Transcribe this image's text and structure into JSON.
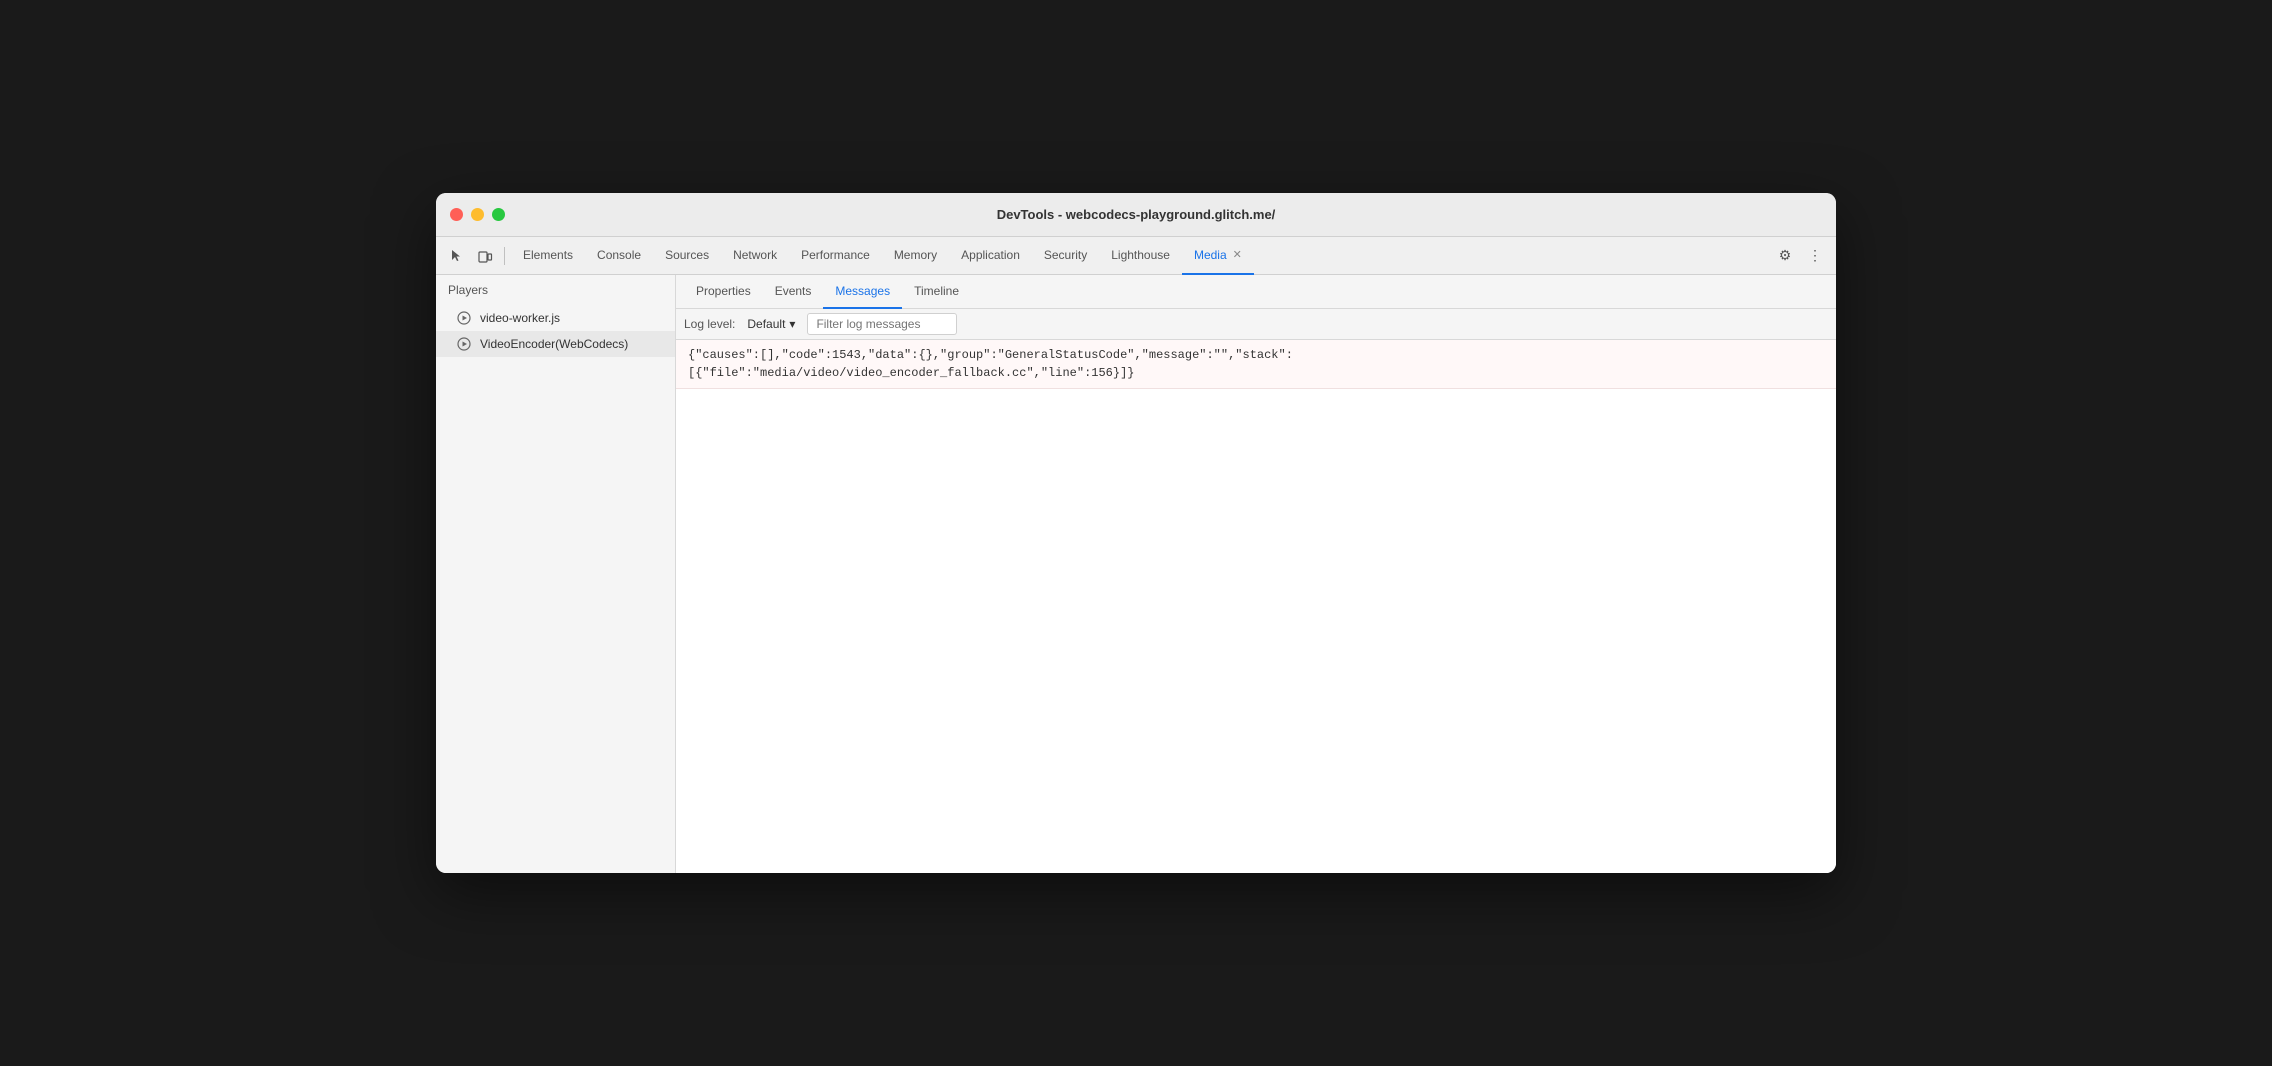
{
  "window": {
    "title": "DevTools - webcodecs-playground.glitch.me/"
  },
  "trafficLights": {
    "red_label": "close",
    "yellow_label": "minimize",
    "green_label": "maximize"
  },
  "toolbar": {
    "inspect_icon": "⬚",
    "device_icon": "▭",
    "tabs": [
      {
        "id": "elements",
        "label": "Elements",
        "active": false
      },
      {
        "id": "console",
        "label": "Console",
        "active": false
      },
      {
        "id": "sources",
        "label": "Sources",
        "active": false
      },
      {
        "id": "network",
        "label": "Network",
        "active": false
      },
      {
        "id": "performance",
        "label": "Performance",
        "active": false
      },
      {
        "id": "memory",
        "label": "Memory",
        "active": false
      },
      {
        "id": "application",
        "label": "Application",
        "active": false
      },
      {
        "id": "security",
        "label": "Security",
        "active": false
      },
      {
        "id": "lighthouse",
        "label": "Lighthouse",
        "active": false
      },
      {
        "id": "media",
        "label": "Media",
        "active": true,
        "closeable": true
      }
    ],
    "settings_icon": "⚙",
    "more_icon": "⋮"
  },
  "sidebar": {
    "header": "Players",
    "players": [
      {
        "id": "video-worker",
        "label": "video-worker.js",
        "selected": false
      },
      {
        "id": "video-encoder",
        "label": "VideoEncoder(WebCodecs)",
        "selected": true
      }
    ]
  },
  "subTabs": [
    {
      "id": "properties",
      "label": "Properties",
      "active": false
    },
    {
      "id": "events",
      "label": "Events",
      "active": false
    },
    {
      "id": "messages",
      "label": "Messages",
      "active": true
    },
    {
      "id": "timeline",
      "label": "Timeline",
      "active": false
    }
  ],
  "logToolbar": {
    "log_level_label": "Log level:",
    "log_level_value": "Default",
    "dropdown_icon": "▾",
    "filter_placeholder": "Filter log messages"
  },
  "logEntries": [
    {
      "line1": "{\"causes\":[],\"code\":1543,\"data\":{},\"group\":\"GeneralStatusCode\",\"message\":\"\",\"stack\":",
      "line2": "[{\"file\":\"media/video/video_encoder_fallback.cc\",\"line\":156}]}"
    }
  ]
}
